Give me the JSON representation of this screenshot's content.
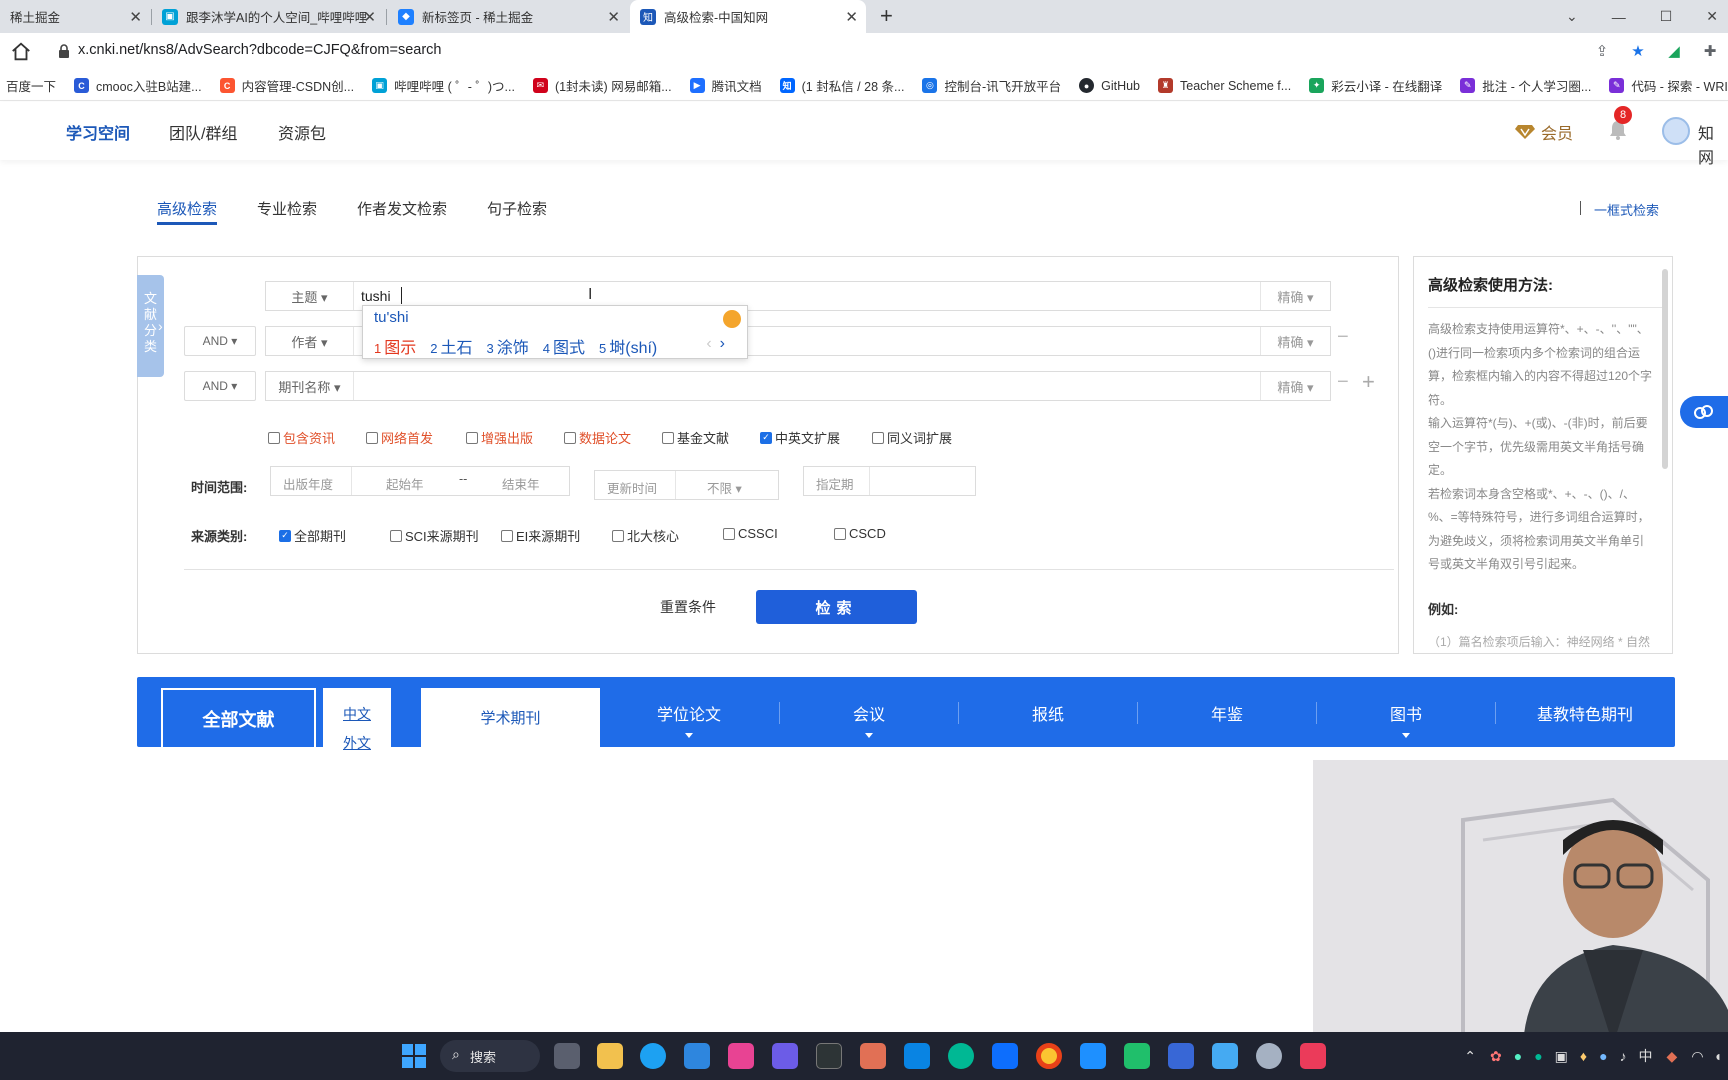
{
  "browser": {
    "tabs": [
      {
        "title": "稀土掘金",
        "color": "#1e80ff"
      },
      {
        "title": "跟李沐学AI的个人空间_哔哩哔哩",
        "color": "#00a1d6"
      },
      {
        "title": "新标签页 - 稀土掘金",
        "color": "#1e80ff"
      },
      {
        "title": "高级检索-中国知网",
        "color": "#1c58b8"
      }
    ],
    "url": "x.cnki.net/kns8/AdvSearch?dbcode=CJFQ&from=search",
    "bookmarks": [
      {
        "label": "百度一下",
        "color": ""
      },
      {
        "label": "cmooc入驻B站建...",
        "color": "#2a5bd7"
      },
      {
        "label": "内容管理-CSDN创...",
        "color": "#fc5531"
      },
      {
        "label": "哔哩哔哩 ( ゜- ゜)つ...",
        "color": "#00a1d6"
      },
      {
        "label": "(1封未读) 网易邮箱...",
        "color": "#d0021b"
      },
      {
        "label": "腾讯文档",
        "color": "#1e6fff"
      },
      {
        "label": "(1 封私信 / 28 条...",
        "color": "#0066ff"
      },
      {
        "label": "控制台-讯飞开放平台",
        "color": "#1a74e8"
      },
      {
        "label": "GitHub",
        "color": "#24292f"
      },
      {
        "label": "Teacher Scheme f...",
        "color": "#b33a2b"
      },
      {
        "label": "彩云小译 - 在线翻译",
        "color": "#1aa55c"
      },
      {
        "label": "批注 - 个人学习圈...",
        "color": "#7a2fd8"
      },
      {
        "label": "代码 - 探索 - WRIT...",
        "color": "#7a2fd8"
      }
    ]
  },
  "header": {
    "nav": [
      "学习空间",
      "团队/群组",
      "资源包"
    ],
    "vip_label": "会员",
    "notification_count": "8",
    "user_label": "知网"
  },
  "search_tabs": {
    "items": [
      "高级检索",
      "专业检索",
      "作者发文检索",
      "句子检索"
    ],
    "onebox": "一框式检索"
  },
  "side_tab": "文献分类",
  "rows": [
    {
      "logic": "",
      "field": "主题 ▾",
      "value": "tushi",
      "match": "精确 ▾"
    },
    {
      "logic": "AND ▾",
      "field": "作者 ▾",
      "value": "",
      "match": "精确 ▾"
    },
    {
      "logic": "AND ▾",
      "field": "期刊名称 ▾",
      "value": "",
      "match": "精确 ▾"
    }
  ],
  "ime": {
    "composition": "tu'shi",
    "candidates": [
      {
        "num": "1",
        "text": "图示"
      },
      {
        "num": "2",
        "text": "土石"
      },
      {
        "num": "3",
        "text": "涂饰"
      },
      {
        "num": "4",
        "text": "图式"
      },
      {
        "num": "5",
        "text": "埘(shí)"
      }
    ],
    "prev": "‹",
    "next": "›"
  },
  "options": [
    {
      "label": "包含资讯",
      "checked": false,
      "red": true
    },
    {
      "label": "网络首发",
      "checked": false,
      "red": true
    },
    {
      "label": "增强出版",
      "checked": false,
      "red": true
    },
    {
      "label": "数据论文",
      "checked": false,
      "red": true
    },
    {
      "label": "基金文献",
      "checked": false,
      "red": false
    },
    {
      "label": "中英文扩展",
      "checked": true,
      "red": false
    },
    {
      "label": "同义词扩展",
      "checked": false,
      "red": false
    }
  ],
  "time": {
    "label": "时间范围:",
    "pub_year": "出版年度",
    "start": "起始年",
    "dash": "--",
    "end": "结束年",
    "update_label": "更新时间",
    "update_value": "不限 ▾",
    "designated": "指定期"
  },
  "source": {
    "label": "来源类别:",
    "items": [
      {
        "label": "全部期刊",
        "checked": true
      },
      {
        "label": "SCI来源期刊",
        "checked": false
      },
      {
        "label": "EI来源期刊",
        "checked": false
      },
      {
        "label": "北大核心",
        "checked": false
      },
      {
        "label": "CSSCI",
        "checked": false
      },
      {
        "label": "CSCD",
        "checked": false
      }
    ]
  },
  "actions": {
    "reset": "重置条件",
    "search": "检索"
  },
  "help": {
    "title": "高级检索使用方法:",
    "paragraphs": [
      "高级检索支持使用运算符*、+、-、''、\"\"、()进行同一检索项内多个检索词的组合运算，检索框内输入的内容不得超过120个字符。",
      "输入运算符*(与)、+(或)、-(非)时，前后要空一个字节，优先级需用英文半角括号确定。",
      "若检索词本身含空格或*、+、-、()、/、%、=等特殊符号，进行多词组合运算时，为避免歧义，须将检索词用英文半角单引号或英文半角双引号引起来。"
    ],
    "example_title": "例如:",
    "example_first": "（1）篇名检索项后输入：神经网络 * 自然"
  },
  "categories": {
    "all": "全部文献",
    "zh": "中文",
    "foreign": "外文",
    "items": [
      "学术期刊",
      "学位论文",
      "会议",
      "报纸",
      "年鉴",
      "图书",
      "基教特色期刊"
    ]
  },
  "taskbar": {
    "search": "搜索",
    "ime_lang": "中"
  }
}
